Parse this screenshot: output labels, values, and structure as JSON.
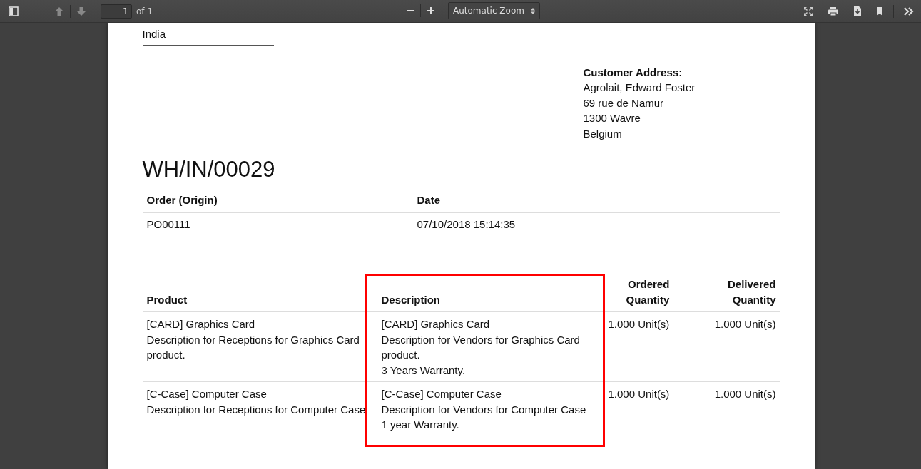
{
  "toolbar": {
    "page_number": "1",
    "page_count": "of 1",
    "zoom": "Automatic Zoom"
  },
  "document": {
    "sender_country": "India",
    "customer_address": {
      "label": "Customer Address:",
      "lines": [
        "Agrolait, Edward Foster",
        "69 rue de Namur",
        "1300 Wavre",
        "Belgium"
      ]
    },
    "title": "WH/IN/00029",
    "order_table": {
      "columns": [
        "Order (Origin)",
        "Date"
      ],
      "rows": [
        [
          "PO00111",
          "07/10/2018 15:14:35"
        ]
      ]
    },
    "product_table": {
      "columns": [
        [
          "Product"
        ],
        [
          "Description"
        ],
        [
          "Ordered",
          "Quantity"
        ],
        [
          "Delivered",
          "Quantity"
        ]
      ],
      "rows": [
        {
          "product": [
            "[CARD] Graphics Card",
            "Description for Receptions for Graphics Card product."
          ],
          "description": [
            "[CARD] Graphics Card",
            "Description for Vendors for Graphics Card product.",
            "3 Years Warranty."
          ],
          "ordered": "1.000 Unit(s)",
          "delivered": "1.000 Unit(s)"
        },
        {
          "product": [
            "[C-Case] Computer Case",
            "Description for Receptions for Computer Case"
          ],
          "description": [
            "[C-Case] Computer Case",
            "Description for Vendors for Computer Case",
            "1 year Warranty."
          ],
          "ordered": "1.000 Unit(s)",
          "delivered": "1.000 Unit(s)"
        }
      ]
    }
  }
}
